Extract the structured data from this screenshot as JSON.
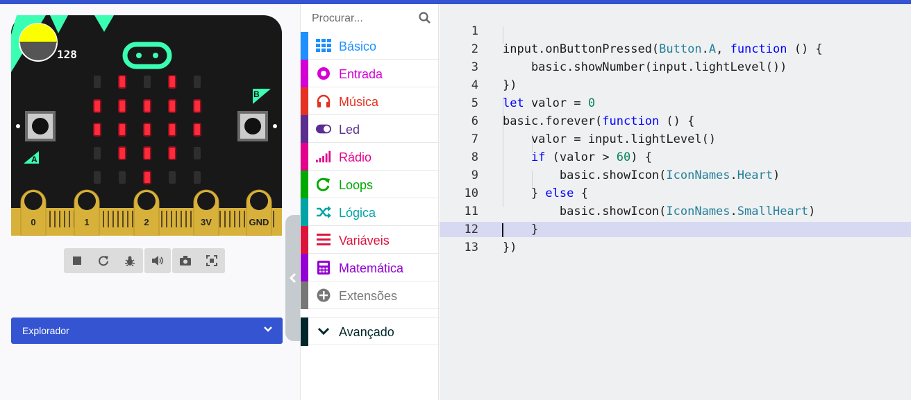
{
  "simulator": {
    "light_level": "128",
    "button_a": "A",
    "button_b": "B",
    "pins": [
      "0",
      "1",
      "2",
      "3V",
      "GND"
    ],
    "explorer_label": "Explorador"
  },
  "toolbox": {
    "search_placeholder": "Procurar...",
    "categories": [
      {
        "label": "Básico",
        "color": "#1e90ff"
      },
      {
        "label": "Entrada",
        "color": "#d400d4"
      },
      {
        "label": "Música",
        "color": "#e63022"
      },
      {
        "label": "Led",
        "color": "#5c2d91"
      },
      {
        "label": "Rádio",
        "color": "#e3008c"
      },
      {
        "label": "Loops",
        "color": "#00aa00"
      },
      {
        "label": "Lógica",
        "color": "#00a4a6"
      },
      {
        "label": "Variáveis",
        "color": "#dc143c"
      },
      {
        "label": "Matemática",
        "color": "#9400d3"
      },
      {
        "label": "Extensões",
        "color": "#777777"
      },
      {
        "label": "Avançado",
        "color": "#00272b"
      }
    ]
  },
  "editor": {
    "line_numbers": [
      "1",
      "2",
      "3",
      "4",
      "5",
      "6",
      "7",
      "8",
      "9",
      "10",
      "11",
      "12",
      "13"
    ],
    "code": {
      "l1a": "input.onButtonPressed(",
      "l1b": "Button",
      "l1c": ".",
      "l1d": "A",
      "l1e": ", ",
      "l1f": "function",
      "l1g": " () {",
      "l2": "    basic.showNumber(input.lightLevel())",
      "l3": "})",
      "l4a": "let",
      "l4b": " valor = ",
      "l4c": "0",
      "l5a": "basic.forever(",
      "l5b": "function",
      "l5c": " () {",
      "l6": "    valor = input.lightLevel()",
      "l7a": "    ",
      "l7b": "if",
      "l7c": " (valor > ",
      "l7d": "60",
      "l7e": ") {",
      "l8a": "        basic.showIcon(",
      "l8b": "IconNames",
      "l8c": ".",
      "l8d": "Heart",
      "l8e": ")",
      "l9a": "    } ",
      "l9b": "else",
      "l9c": " {",
      "l10a": "        basic.showIcon(",
      "l10b": "IconNames",
      "l10c": ".",
      "l10d": "SmallHeart",
      "l10e": ")",
      "l11": "    }",
      "l12": "})",
      "l13": ""
    }
  },
  "colors": {
    "accent": "#3454d1",
    "board": "#181818",
    "gold": "#d8b13a",
    "mint": "#3affb3",
    "led_on": "#ff2a3a"
  }
}
